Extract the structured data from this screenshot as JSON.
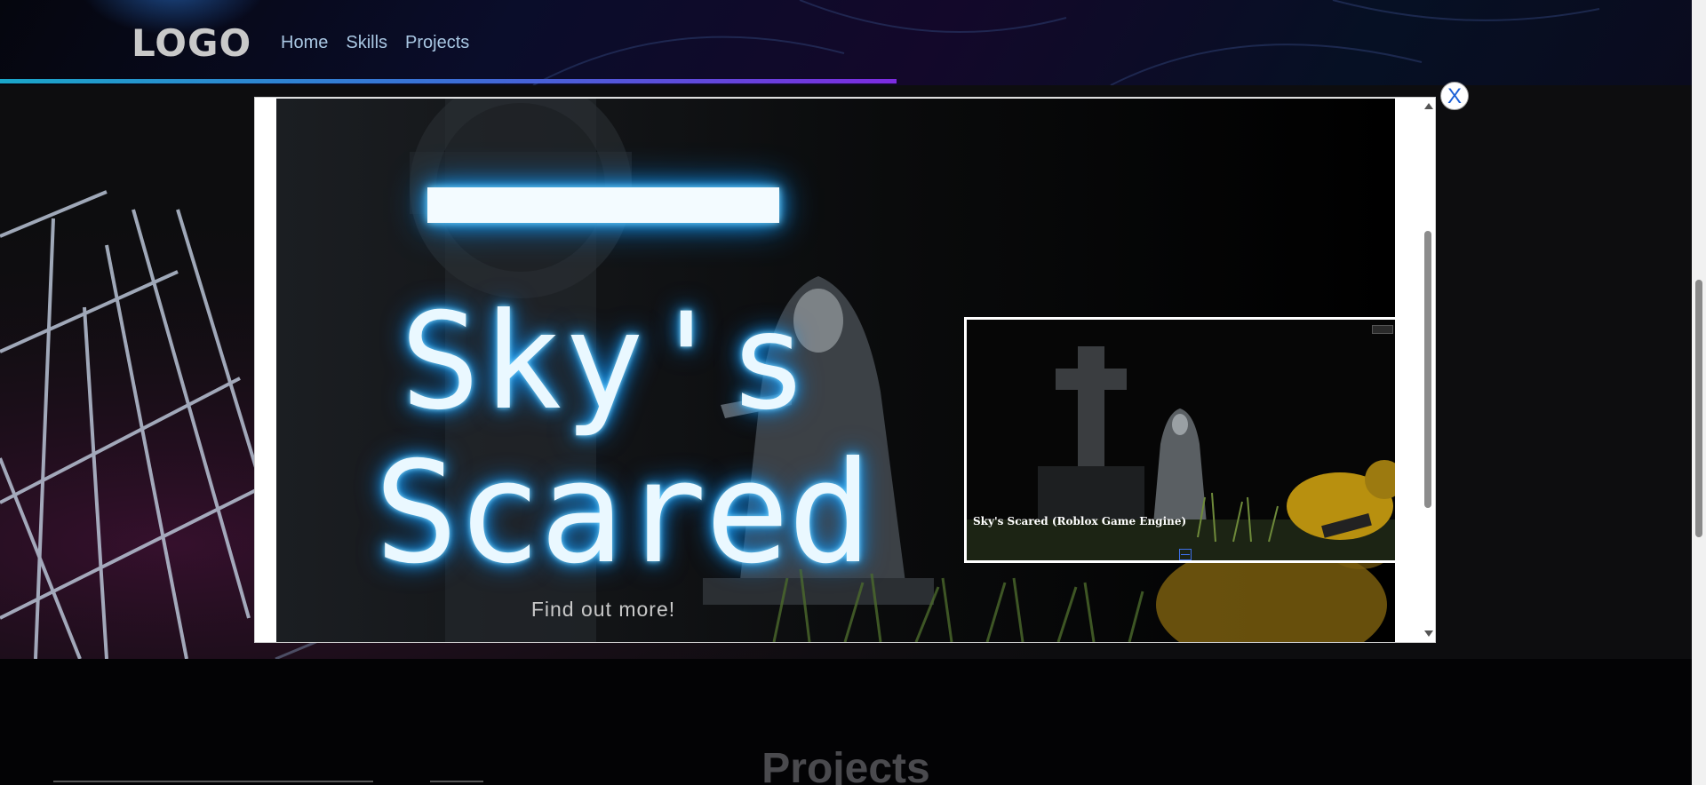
{
  "header": {
    "logo": "LOGO",
    "nav": [
      {
        "label": "Home"
      },
      {
        "label": "Skills"
      },
      {
        "label": "Projects"
      }
    ],
    "scroll_progress_percent": 53
  },
  "modal": {
    "close_label": "X",
    "game": {
      "title_line1": "Sky's",
      "title_line2": "Scared",
      "cta": "Find out more!"
    },
    "video": {
      "caption": "Sky's Scared (Roblox Game Engine)"
    }
  },
  "sections": {
    "projects_title": "Projects"
  },
  "colors": {
    "accent_glow": "#1fa6ff",
    "progress_start": "#1aa6c9",
    "progress_end": "#7d2be0",
    "nav_link": "#a9c7e3"
  }
}
